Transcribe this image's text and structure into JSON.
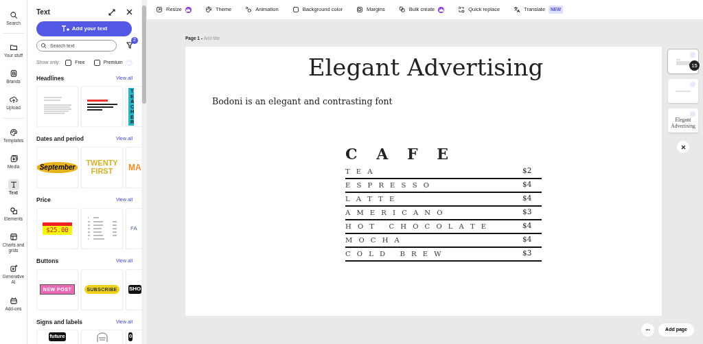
{
  "rail": [
    {
      "label": "Search",
      "selected": false,
      "divider_after": true
    },
    {
      "label": "Your stuff",
      "selected": false
    },
    {
      "label": "Brands",
      "selected": false
    },
    {
      "label": "Upload",
      "selected": false,
      "divider_after": true
    },
    {
      "label": "Templates",
      "selected": false
    },
    {
      "label": "Media",
      "selected": false
    },
    {
      "label": "Text",
      "selected": true
    },
    {
      "label": "Elements",
      "selected": false
    },
    {
      "label": "Charts and grids",
      "selected": false
    },
    {
      "label": "Generative AI",
      "selected": false
    },
    {
      "label": "Add-ons",
      "selected": false
    }
  ],
  "panel": {
    "title": "Text",
    "add_button": "Add your text",
    "search": {
      "placeholder": "Search text"
    },
    "filter_count": "2",
    "show_only": "Show only:",
    "filters": [
      {
        "label": "Free",
        "checked": false,
        "premium": false
      },
      {
        "label": "Premium",
        "checked": false,
        "premium": true
      }
    ],
    "sections": [
      {
        "title": "Headlines",
        "view_all": "View all",
        "thumbs": [
          {
            "kind": "serif-lines"
          },
          {
            "kind": "bold-lines"
          },
          {
            "kind": "vertical",
            "text": "TEACHER"
          }
        ]
      },
      {
        "title": "Dates and period",
        "view_all": "View all",
        "thumbs": [
          {
            "kind": "script",
            "text": "September"
          },
          {
            "kind": "gold",
            "text": "TWENTY FIRST"
          },
          {
            "kind": "orange",
            "text": "MA"
          }
        ]
      },
      {
        "title": "Price",
        "view_all": "View all",
        "thumbs": [
          {
            "kind": "tag",
            "text": "$25.00"
          },
          {
            "kind": "price-list"
          },
          {
            "kind": "plain",
            "text": "FA"
          }
        ]
      },
      {
        "title": "Buttons",
        "view_all": "View all",
        "thumbs": [
          {
            "kind": "pink",
            "text": "NEW POST"
          },
          {
            "kind": "yellow",
            "text": "SUBSCRIBE"
          },
          {
            "kind": "black",
            "text": "SHO"
          }
        ]
      },
      {
        "title": "Signs and labels",
        "view_all": "View all",
        "thumbs": [
          {
            "kind": "black",
            "text": "future"
          },
          {
            "kind": "emblem"
          },
          {
            "kind": "black",
            "text": "0"
          }
        ]
      }
    ]
  },
  "toolbar": [
    {
      "label": "Resize",
      "premium": true
    },
    {
      "label": "Theme",
      "premium": false
    },
    {
      "label": "Animation",
      "premium": false
    },
    {
      "label": "Background color",
      "premium": false
    },
    {
      "label": "Margins",
      "premium": false
    },
    {
      "label": "Bulk create",
      "premium": true
    },
    {
      "label": "Quick replace",
      "premium": false
    },
    {
      "label": "Translate",
      "premium": false,
      "badge": "NEW"
    }
  ],
  "page": {
    "label": "Page 1 -",
    "title_placeholder": "Add title",
    "heading": "Elegant Advertising",
    "body": "Bodoni is an elegant and contrasting font",
    "menu_title": "C A F E",
    "menu": [
      {
        "item": "T E A",
        "price": "$2"
      },
      {
        "item": "E S P R E S S O",
        "price": "$4"
      },
      {
        "item": "L A T T E",
        "price": "$4"
      },
      {
        "item": "A M E R I C A N O",
        "price": "$3"
      },
      {
        "item": "H O T   C H O C O L A T E",
        "price": "$4"
      },
      {
        "item": "M O C H A",
        "price": "$4"
      },
      {
        "item": "C O L D   B R E W",
        "price": "$3"
      }
    ]
  },
  "pages": [
    {
      "kind": "menu",
      "selected": true,
      "badge": "15"
    },
    {
      "kind": "line",
      "selected": false
    },
    {
      "kind": "caption",
      "selected": false,
      "caption": "Elegant Advertising"
    }
  ],
  "more_button": "•••",
  "add_page": "Add page"
}
